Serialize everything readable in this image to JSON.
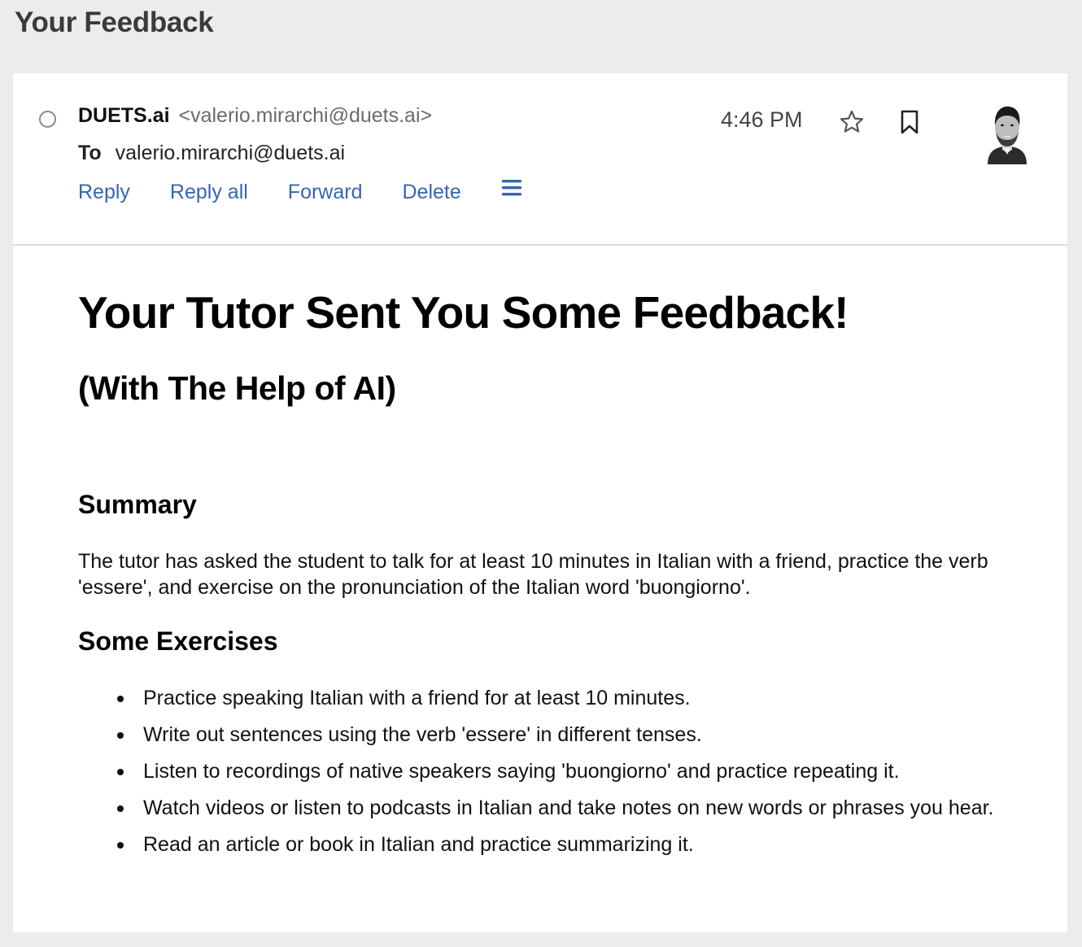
{
  "page": {
    "heading": "Your Feedback"
  },
  "email": {
    "from_name": "DUETS.ai",
    "from_email": "<valerio.mirarchi@duets.ai>",
    "to_label": "To",
    "to_address": "valerio.mirarchi@duets.ai",
    "time": "4:46 PM",
    "actions": {
      "reply": "Reply",
      "reply_all": "Reply all",
      "forward": "Forward",
      "delete": "Delete"
    },
    "icons": {
      "unread": "unread-circle-icon",
      "menu": "hamburger-menu-icon",
      "star": "star-icon",
      "bookmark": "bookmark-icon",
      "avatar": "sender-avatar"
    },
    "colors": {
      "link": "#3567b0",
      "background": "#ececec",
      "card": "#ffffff"
    }
  },
  "body": {
    "title": "Your Tutor Sent You Some Feedback!",
    "subtitle": "(With The Help of AI)",
    "summary_heading": "Summary",
    "summary_text": "The tutor has asked the student to talk for at least 10 minutes in Italian with a friend, practice the verb 'essere', and exercise on the pronunciation of the Italian word 'buongiorno'.",
    "exercises_heading": "Some Exercises",
    "exercises": [
      "Practice speaking Italian with a friend for at least 10 minutes.",
      "Write out sentences using the verb 'essere' in different tenses.",
      "Listen to recordings of native speakers saying 'buongiorno' and practice repeating it.",
      "Watch videos or listen to podcasts in Italian and take notes on new words or phrases you hear.",
      "Read an article or book in Italian and practice summarizing it."
    ]
  }
}
